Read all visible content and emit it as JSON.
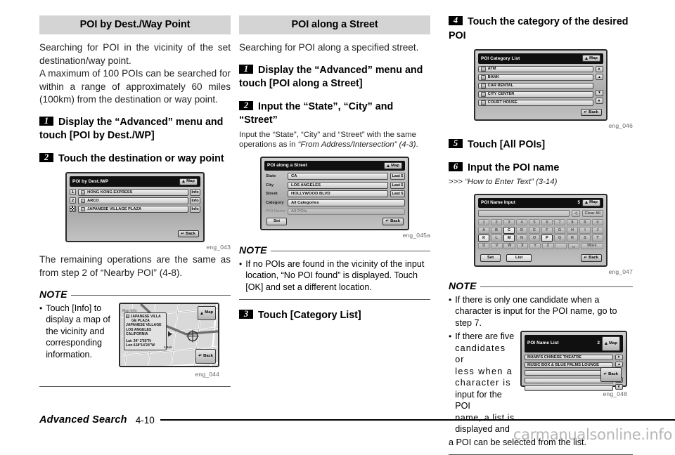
{
  "page": {
    "footer_title": "Advanced Search",
    "footer_page": "4-10",
    "watermark": "carmanualsonline.info"
  },
  "col1": {
    "section_title": "POI by Dest./Way Point",
    "intro_1": "Searching for POI in the vicinity of the set destination/way point.",
    "intro_2": "A maximum of 100 POIs can be searched for within a range of approximately 60 miles (100km) from the destination or way point.",
    "step1_num": "1",
    "step1_text": "Display the “Advanced” menu and touch [POI by Dest./WP]",
    "step2_num": "2",
    "step2_text": "Touch the destination or way point",
    "fig1_caption": "eng_043",
    "after_fig": "The remaining operations are the same as from step 2 of “Nearby POI” (4-8).",
    "note_title": "NOTE",
    "note_bullet": "Touch [Info] to display a map of the vicinity and corresponding information.",
    "fig2_caption": "eng_044",
    "screen1": {
      "title": "POI by Dest./WP",
      "map_button": "Map",
      "back_button": "Back",
      "rows": [
        {
          "index": "1",
          "label": "HONG KONG EXPRESS",
          "info": "Info"
        },
        {
          "index": "2",
          "label": "ARCO",
          "info": "Info"
        },
        {
          "index": "flag",
          "label": "JAPANESE VILLAGE PLAZA",
          "info": "Info"
        }
      ]
    },
    "screen2": {
      "corner_label": "Map Info",
      "map_button": "Map",
      "back_button": "Back",
      "scale_label": "1/4mi",
      "info_lines": [
        "JAPANESE VILLA",
        "GE PLAZA",
        "JAPANESE VILLAGE",
        "LOS ANGELES",
        "CALIFORNIA"
      ],
      "lat": "Lat:  34° 2′55″N",
      "lon": "Lon:118°14′24″W"
    }
  },
  "col2": {
    "section_title": "POI along a Street",
    "intro_1": "Searching for POI along a specified street.",
    "step1_num": "1",
    "step1_text": "Display the “Advanced” menu and touch [POI along a Street]",
    "step2_num": "2",
    "step2_text": "Input the “State”, “City” and “Street”",
    "step2_sub_a": "Input the “State”, “City” and “Street” with the same operations as in ",
    "step2_sub_b": "“From Address/Intersection” (4-3)",
    "step2_sub_c": ".",
    "fig_caption": "eng_045a",
    "note_title": "NOTE",
    "note_bullet": "If no POIs are found in the vicinity of the input location, “No POI found” is displayed. Touch [OK] and set a different location.",
    "step3_num": "3",
    "step3_text": "Touch [Category List]",
    "screen": {
      "title": "POI along a Street",
      "map_button": "Map",
      "back_button": "Back",
      "set_button": "Set",
      "fields": [
        {
          "label": "State",
          "value": "CA",
          "last": "Last 5",
          "dim": false
        },
        {
          "label": "City",
          "value": "LOS ANGELES",
          "last": "Last 5",
          "dim": false
        },
        {
          "label": "Street",
          "value": "HOLLYWOOD BLVD",
          "last": "Last 5",
          "dim": false
        },
        {
          "label": "Category",
          "value": "All Categories",
          "last": "",
          "dim": false
        },
        {
          "label": "POI Name",
          "value": "All POIs",
          "last": "",
          "dim": true
        }
      ]
    }
  },
  "col3": {
    "step4_num": "4",
    "step4_text": "Touch the category of the desired POI",
    "fig4_caption": "eng_046",
    "step5_num": "5",
    "step5_text": "Touch [All POIs]",
    "step6_num": "6",
    "step6_text": "Input the POI name",
    "step6_sub_marker": ">>>",
    "step6_sub_ref": "“How to Enter Text” (3-14)",
    "fig6_caption": "eng_047",
    "note_title": "NOTE",
    "note_bullet_1": "If there is only one candidate when a character is input for the POI name, go to step 7.",
    "note_bullet_2_wrapped": [
      "If there are five",
      "candidates or",
      "less when a",
      "character is",
      "input for the POI",
      "name, a list is",
      "displayed and"
    ],
    "note_bullet_2_tail": "a POI can be selected from the list.",
    "fig8_caption": "eng_048",
    "category_screen": {
      "title": "POI Category List",
      "map_button": "Map",
      "back_button": "Back",
      "items": [
        "ATM",
        "BANK",
        "CAR RENTAL",
        "CITY CENTER",
        "COURT HOUSE"
      ]
    },
    "keyboard_screen": {
      "title": "POI Name Input",
      "count": "5",
      "map_button": "Map",
      "back_button": "Back",
      "clear_all": "Clear All",
      "backspace": "◁",
      "set_button": "Set",
      "list_button": "List",
      "more_button": "More",
      "input_value": "",
      "rows": [
        [
          "1",
          "2",
          "3",
          "4",
          "5",
          "6",
          "7",
          "8",
          "9",
          "0"
        ],
        [
          "A",
          "B",
          "C",
          "D",
          "E",
          "F",
          "G",
          "H",
          "I",
          "J"
        ],
        [
          "K",
          "L",
          "M",
          "N",
          "O",
          "P",
          "Q",
          "R",
          "S",
          "T"
        ],
        [
          "U",
          "V",
          "W",
          "X",
          "Y",
          "Z"
        ]
      ],
      "active_keys": [
        "C",
        "K",
        "M",
        "P"
      ],
      "space_key": "␣"
    },
    "name_list_screen": {
      "title": "POI Name List",
      "count": "2",
      "map_button": "Map",
      "back_button": "Back",
      "items": [
        "MANN'S CHINESE THEATRE",
        "MUSIC BOX & BLUE PALMS LOUNGE",
        "",
        "",
        ""
      ]
    }
  }
}
